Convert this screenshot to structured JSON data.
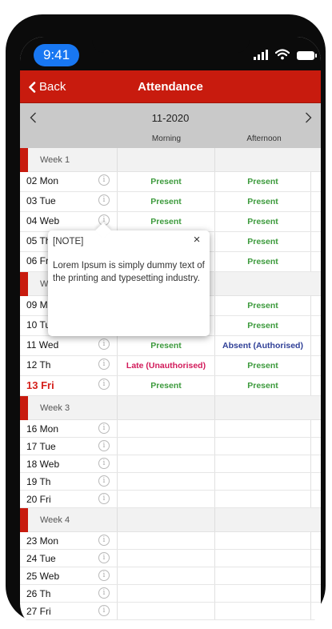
{
  "status_bar": {
    "time": "9:41",
    "icons": [
      "signal-icon",
      "wifi-icon",
      "battery-icon"
    ]
  },
  "header": {
    "back_label": "Back",
    "title": "Attendance"
  },
  "month_nav": {
    "month": "11-2020",
    "col_morning": "Morning",
    "col_afternoon": "Afternoon"
  },
  "colors": {
    "accent": "#c81b0e",
    "present": "#3c9a3c",
    "late": "#d21a5a",
    "absent": "#2f3f97",
    "today": "#d5201b"
  },
  "weeks": [
    {
      "label": "Week 1",
      "days": [
        {
          "label": "02 Mon",
          "morning": "Present",
          "afternoon": "Present"
        },
        {
          "label": "03 Tue",
          "morning": "Present",
          "afternoon": "Present"
        },
        {
          "label": "04 Web",
          "morning": "Present",
          "afternoon": "Present"
        },
        {
          "label": "05 Th",
          "morning": "",
          "afternoon": "Present"
        },
        {
          "label": "06 Fr",
          "morning": "",
          "afternoon": "Present"
        }
      ]
    },
    {
      "label": "W",
      "days": [
        {
          "label": "09 M",
          "morning": "",
          "afternoon": "Present"
        },
        {
          "label": "10 Tu",
          "morning": "",
          "afternoon": "Present"
        },
        {
          "label": "11 Wed",
          "morning": "Present",
          "afternoon": "Absent (Authorised)"
        },
        {
          "label": "12 Th",
          "morning": "Late (Unauthorised)",
          "afternoon": "Present"
        },
        {
          "label": "13 Fri",
          "morning": "Present",
          "afternoon": "Present",
          "today": true
        }
      ]
    },
    {
      "label": "Week 3",
      "days": [
        {
          "label": "16 Mon",
          "morning": "",
          "afternoon": ""
        },
        {
          "label": "17 Tue",
          "morning": "",
          "afternoon": ""
        },
        {
          "label": "18 Web",
          "morning": "",
          "afternoon": ""
        },
        {
          "label": "19 Th",
          "morning": "",
          "afternoon": ""
        },
        {
          "label": "20 Fri",
          "morning": "",
          "afternoon": ""
        }
      ]
    },
    {
      "label": "Week 4",
      "days": [
        {
          "label": "23 Mon",
          "morning": "",
          "afternoon": ""
        },
        {
          "label": "24 Tue",
          "morning": "",
          "afternoon": ""
        },
        {
          "label": "25 Web",
          "morning": "",
          "afternoon": ""
        },
        {
          "label": "26 Th",
          "morning": "",
          "afternoon": ""
        },
        {
          "label": "27 Fri",
          "morning": "",
          "afternoon": ""
        }
      ]
    }
  ],
  "note_popup": {
    "title": "[NOTE]",
    "close_glyph": "×",
    "body": "Lorem Ipsum is simply dummy text of the printing and typesetting industry."
  }
}
